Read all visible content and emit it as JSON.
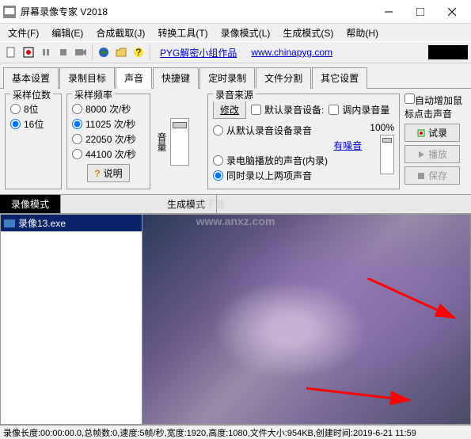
{
  "title": "屏幕录像专家 V2018",
  "menu": [
    "文件(F)",
    "编辑(E)",
    "合成截取(J)",
    "转换工具(T)",
    "录像模式(L)",
    "生成模式(S)",
    "帮助(H)"
  ],
  "toolbar": {
    "link1": "PYG解密小组作品",
    "link2": "www.chinapyg.com"
  },
  "tabs": [
    "基本设置",
    "录制目标",
    "声音",
    "快捷键",
    "定时录制",
    "文件分割",
    "其它设置"
  ],
  "active_tab": 2,
  "sample_bits": {
    "legend": "采样位数",
    "opts": [
      "8位",
      "16位"
    ],
    "selected": 1
  },
  "sample_rate": {
    "legend": "采样频率",
    "opts": [
      "8000 次/秒",
      "11025 次/秒",
      "22050 次/秒",
      "44100 次/秒"
    ],
    "selected": 1,
    "help_btn": "说明"
  },
  "volume_label": "音量",
  "source": {
    "legend": "录音来源",
    "modify": "修改",
    "default_check": "默认录音设备:",
    "tune_check": "调内录音量",
    "percent": "100%",
    "opts": [
      "从默认录音设备录音",
      "录电脑播放的声音(内录)",
      "同时录以上两项声音"
    ],
    "noise": "有噪音",
    "selected": 2
  },
  "auto_gain": "自动增加鼠标点击声音",
  "buttons": {
    "try": "试录",
    "play": "播放",
    "save": "保存"
  },
  "mode": {
    "rec": "录像模式",
    "gen": "生成模式"
  },
  "file": "录像13.exe",
  "status": "录像长度:00:00:00.0,总帧数:0,速度:5帧/秒,宽度:1920,高度:1080,文件大小:954KB,创建时间:2019-6-21 11:59",
  "watermark": "安下载",
  "watermark_url": "www.anxz.com"
}
